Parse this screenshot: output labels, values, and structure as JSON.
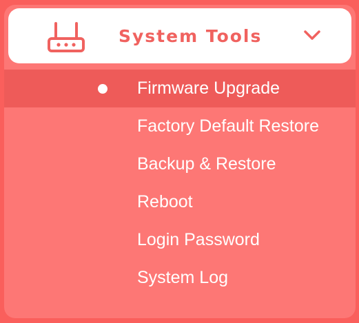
{
  "header": {
    "title": "System Tools",
    "icon": "router-icon",
    "toggle_icon": "chevron-down-icon"
  },
  "menu": {
    "items": [
      {
        "label": "Firmware Upgrade",
        "active": true
      },
      {
        "label": "Factory Default Restore",
        "active": false
      },
      {
        "label": "Backup & Restore",
        "active": false
      },
      {
        "label": "Reboot",
        "active": false
      },
      {
        "label": "Login Password",
        "active": false
      },
      {
        "label": "System Log",
        "active": false
      }
    ]
  },
  "colors": {
    "accent": "#f0625f",
    "panel": "#fd7775",
    "active_row": "#ee5b59",
    "text_on_panel": "#ffffff"
  }
}
